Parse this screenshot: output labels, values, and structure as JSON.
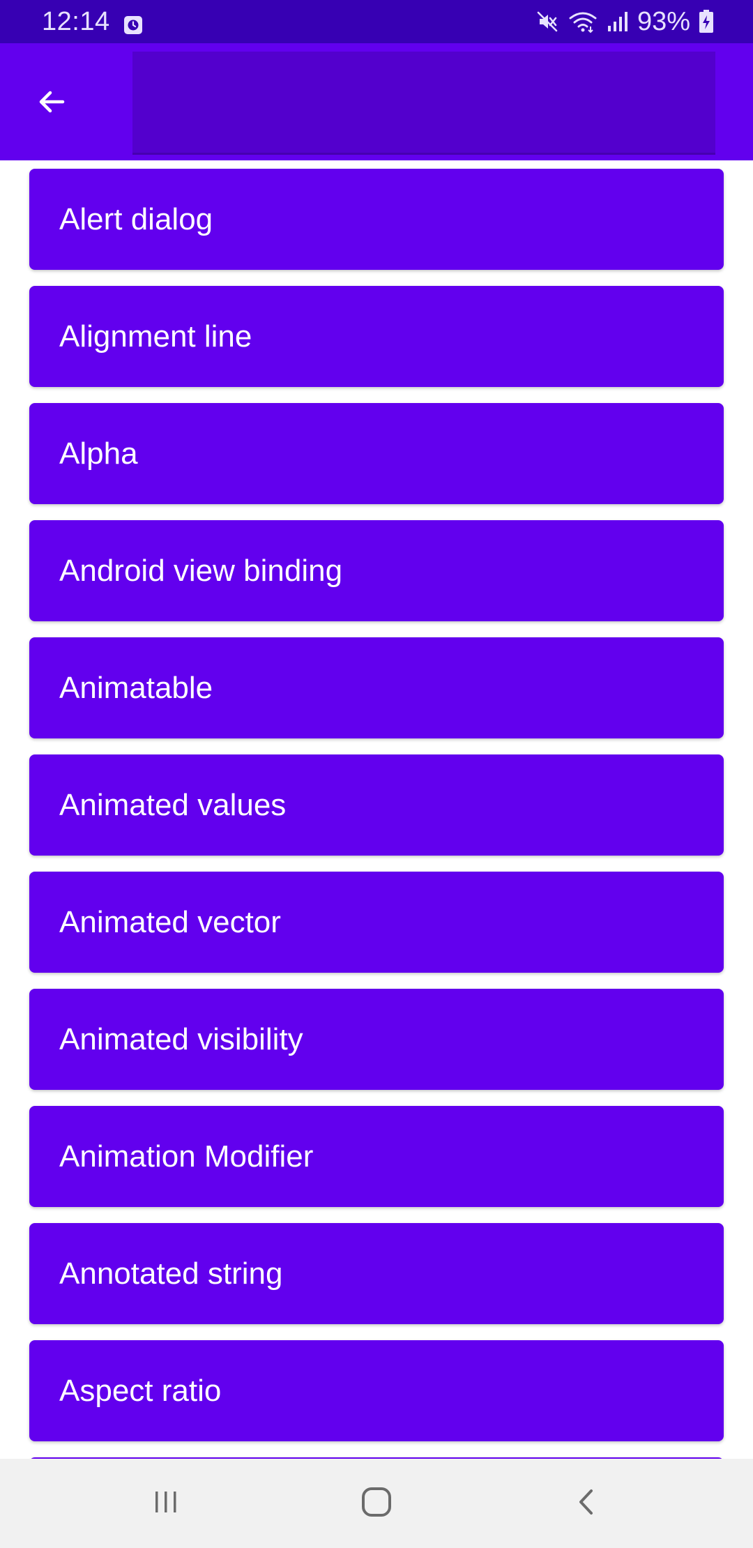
{
  "status_bar": {
    "time": "12:14",
    "battery": "93%",
    "icons": [
      "alarm-icon",
      "mute-icon",
      "wifi-icon",
      "signal-icon",
      "battery-charging-icon"
    ]
  },
  "app_bar": {
    "back_icon": "arrow-back-icon",
    "search_value": "",
    "search_placeholder": ""
  },
  "list": {
    "items": [
      {
        "label": "Alert dialog"
      },
      {
        "label": "Alignment line"
      },
      {
        "label": "Alpha"
      },
      {
        "label": "Android view binding"
      },
      {
        "label": "Animatable"
      },
      {
        "label": "Animated values"
      },
      {
        "label": "Animated vector"
      },
      {
        "label": "Animated visibility"
      },
      {
        "label": "Animation Modifier"
      },
      {
        "label": "Annotated string"
      },
      {
        "label": "Aspect ratio"
      },
      {
        "label": ""
      }
    ]
  },
  "nav_bar": {
    "icons": [
      "recents-icon",
      "home-icon",
      "back-icon"
    ]
  },
  "colors": {
    "primary": "#6200EE",
    "primary_dark": "#3700B3",
    "on_primary": "#FFFFFF",
    "background": "#FFFFFF",
    "nav_bar": "#F1F1F1"
  }
}
